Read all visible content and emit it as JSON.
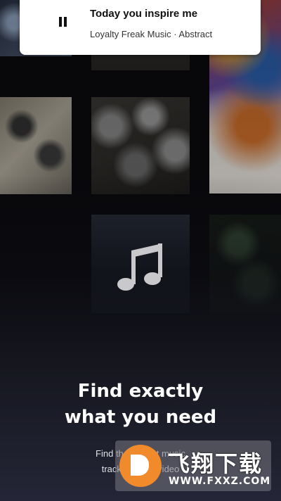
{
  "now_playing": {
    "title": "Today you inspire me",
    "subtitle": "Loyalty Freak Music · Abstract",
    "state": "pause-icon"
  },
  "onboarding": {
    "headline_line1": "Find exactly",
    "headline_line2": "what you need",
    "subtext_line1": "Find the perfect music",
    "subtext_line2": "track for your video"
  },
  "watermark": {
    "cn_text": "飞翔下载",
    "url": "WWW.FXXZ.COM"
  },
  "icons": {
    "center": "music-note-icon",
    "logo": "fxxz-logo-icon"
  },
  "colors": {
    "card_bg": "#ffffff",
    "text_dark": "#111111",
    "headline": "#ffffff",
    "watermark_orange": "#f08a2a"
  }
}
